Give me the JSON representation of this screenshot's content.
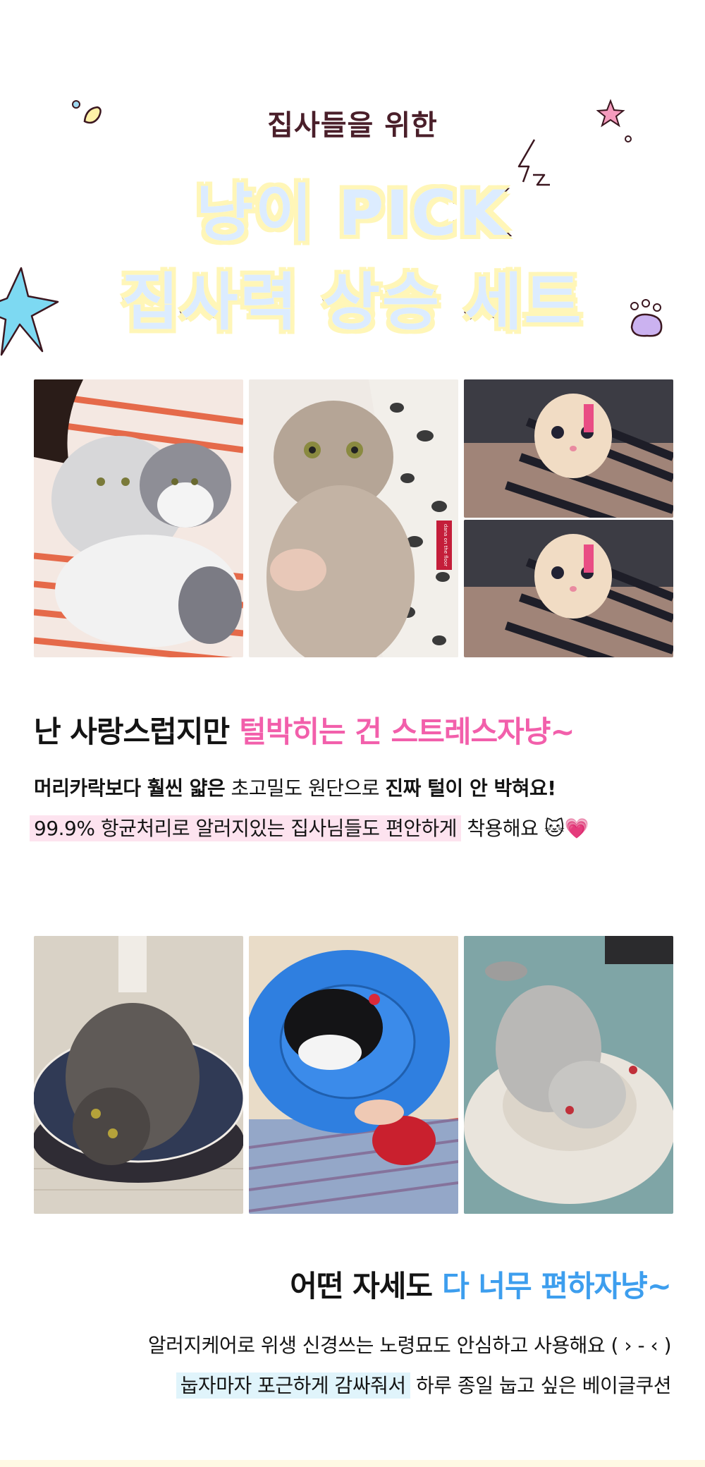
{
  "header": {
    "eyebrow": "집사들을 위한",
    "headline_line1": "냥이 PICK",
    "headline_line2": "집사력 상승 세트"
  },
  "section1": {
    "title_plain": "난 사랑스럽지만",
    "title_accent": "털박히는 건 스트레스자냥~",
    "line1_bold1": "머리카락보다 훨씬 얇은",
    "line1_normal": " 초고밀도 원단으로 ",
    "line1_bold2": "진짜 털이 안 박혀요!",
    "line2_highlight": "99.9% 항균처리로 알러지있는 집사님들도 편안하게",
    "line2_rest": " 착용해요 ",
    "line2_emoji": "🐱💗"
  },
  "photo_tag_text": "dana on the floor",
  "section2": {
    "title_plain": "어떤 자세도",
    "title_accent": "다 너무 편하자냥~",
    "line1": "알러지케어로 위생 신경쓰는 노령묘도 안심하고 사용해요 ( › - ‹ )",
    "line2_highlight": "눕자마자 포근하게 감싸줘서",
    "line2_rest": " 하루 종일 눕고 싶은 베이글쿠션"
  },
  "colors": {
    "accent_pink": "#f25fab",
    "accent_blue": "#3d9eee",
    "headline_fill": "#dcecff",
    "headline_outline": "#3b1720",
    "highlight_pink": "#fde3ef",
    "highlight_blue": "#e0f4fb"
  },
  "icons": [
    "sparkle-icon",
    "star-icon",
    "lightning-icon",
    "starburst-icon",
    "paw-icon",
    "cat-emoji-icon",
    "heart-emoji-icon"
  ]
}
